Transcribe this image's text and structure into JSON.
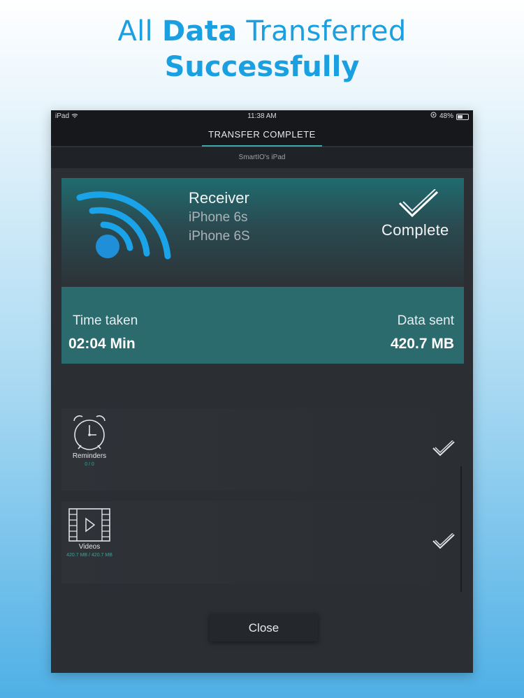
{
  "headline": {
    "prefix": "All",
    "bold": "Data",
    "suffix": "Transferred",
    "line2": "Successfully"
  },
  "status_bar": {
    "device": "iPad",
    "time": "11:38 AM",
    "battery": "48%"
  },
  "nav": {
    "title": "TRANSFER COMPLETE",
    "device_name": "SmartIO's iPad"
  },
  "receiver": {
    "title": "Receiver",
    "model": "iPhone 6s",
    "model_alt": "iPhone 6S",
    "status": "Complete"
  },
  "stats": {
    "time_label": "Time taken",
    "time_value": "02:04 Min",
    "data_label": "Data sent",
    "data_value": "420.7 MB"
  },
  "items": [
    {
      "label": "Reminders",
      "progress": "0 / 0",
      "icon": "alarm-clock-icon"
    },
    {
      "label": "Videos",
      "progress": "420.7 MB / 420.7 MB",
      "icon": "video-icon"
    }
  ],
  "close_label": "Close",
  "colors": {
    "accent": "#1aa0e0",
    "teal": "#2b6a6d",
    "device_bg": "#2b2e32"
  }
}
